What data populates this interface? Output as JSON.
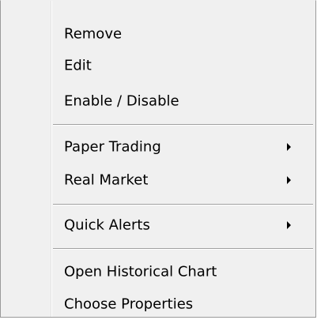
{
  "menu": {
    "items": [
      {
        "label": "Remove"
      },
      {
        "label": "Edit"
      },
      {
        "label": "Enable / Disable"
      },
      {
        "label": "Paper Trading",
        "submenu": true
      },
      {
        "label": "Real Market",
        "submenu": true
      },
      {
        "label": "Quick Alerts",
        "submenu": true
      },
      {
        "label": "Open Historical Chart"
      },
      {
        "label": "Choose Properties"
      }
    ]
  }
}
